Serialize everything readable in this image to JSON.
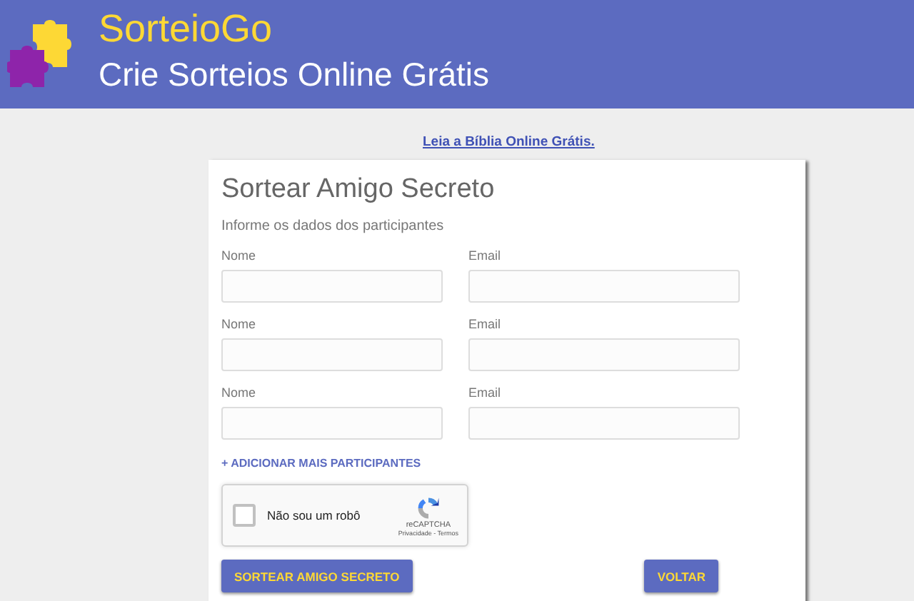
{
  "header": {
    "brand": "SorteioGo",
    "tagline": "Crie Sorteios Online Grátis"
  },
  "top_link": "Leia a Bíblia Online Grátis.",
  "form": {
    "title": "Sortear Amigo Secreto",
    "subtitle": "Informe os dados dos participantes",
    "participants": [
      {
        "name_label": "Nome",
        "email_label": "Email"
      },
      {
        "name_label": "Nome",
        "email_label": "Email"
      },
      {
        "name_label": "Nome",
        "email_label": "Email"
      }
    ],
    "add_link": "+ ADICIONAR MAIS PARTICIPANTES",
    "captcha": {
      "label": "Não sou um robô",
      "checked": false,
      "brand": "reCAPTCHA",
      "terms": "Privacidade - Termos"
    },
    "buttons": [
      "SORTEAR AMIGO SECRETO",
      "VOLTAR"
    ]
  }
}
